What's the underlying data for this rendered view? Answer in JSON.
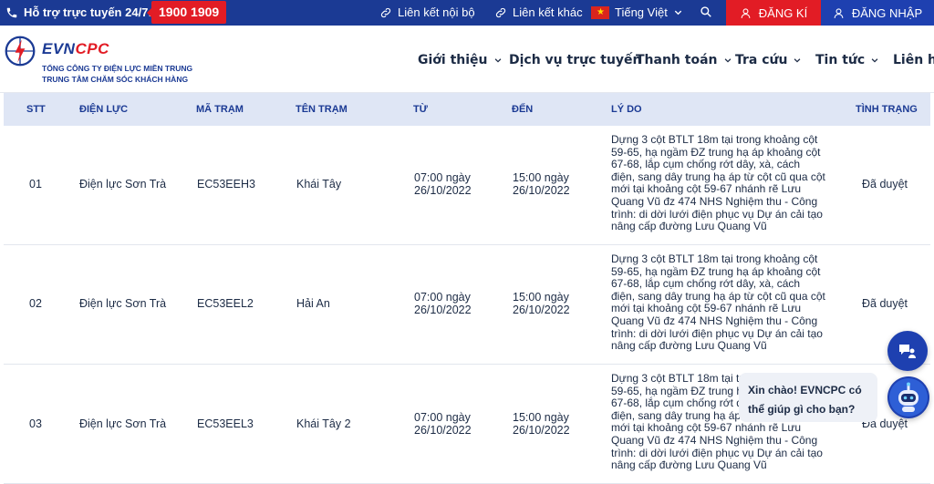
{
  "topbar": {
    "hotline_label": "Hỗ trợ trực tuyến 24/7:",
    "hotline_number": "1900 1909",
    "links": [
      {
        "label": "Liên kết nội bộ",
        "icon": "link-icon"
      },
      {
        "label": "Liên kết khác",
        "icon": "link-icon"
      }
    ],
    "language": "Tiếng Việt",
    "register": "ĐĂNG KÍ",
    "login": "ĐĂNG NHẬP"
  },
  "header": {
    "brand_part1": "EVN",
    "brand_part2": "CPC",
    "subtitle1": "TỔNG CÔNG TY ĐIỆN LỰC MIỀN TRUNG",
    "subtitle2": "TRUNG TÂM CHĂM SÓC KHÁCH HÀNG",
    "nav": [
      "Giới thiệu",
      "Dịch vụ trực tuyến",
      "Thanh toán",
      "Tra cứu",
      "Tin tức",
      "Liên hệ"
    ]
  },
  "table": {
    "columns": [
      "STT",
      "ĐIỆN LỰC",
      "MÃ TRẠM",
      "TÊN TRẠM",
      "TỪ",
      "ĐẾN",
      "LÝ DO",
      "TÌNH TRẠNG"
    ],
    "rows": [
      {
        "stt": "01",
        "dien_luc": "Điện lực Sơn Trà",
        "ma_tram": "EC53EEH3",
        "ten_tram": "Khái Tây",
        "tu_time": "07:00 ngày",
        "tu_date": "26/10/2022",
        "den_time": "15:00 ngày",
        "den_date": "26/10/2022",
        "ly_do": "Dựng 3 cột BTLT 18m tại trong khoảng cột 59-65, hạ ngầm ĐZ trung hạ áp khoảng cột 67-68, lắp cụm chống rớt dây, xà, cách điện, sang dây trung hạ áp từ cột cũ qua cột mới tại khoảng cột 59-67 nhánh rẽ Lưu Quang Vũ đz 474 NHS Nghiệm thu - Công trình: di dời lưới điện phục vụ Dự án cải tạo nâng cấp đường Lưu Quang Vũ",
        "tinh_trang": "Đã duyệt"
      },
      {
        "stt": "02",
        "dien_luc": "Điện lực Sơn Trà",
        "ma_tram": "EC53EEL2",
        "ten_tram": "Hải An",
        "tu_time": "07:00 ngày",
        "tu_date": "26/10/2022",
        "den_time": "15:00 ngày",
        "den_date": "26/10/2022",
        "ly_do": "Dựng 3 cột BTLT 18m tại trong khoảng cột 59-65, hạ ngầm ĐZ trung hạ áp khoảng cột 67-68, lắp cụm chống rớt dây, xà, cách điện, sang dây trung hạ áp từ cột cũ qua cột mới tại khoảng cột 59-67 nhánh rẽ Lưu Quang Vũ đz 474 NHS Nghiệm thu - Công trình: di dời lưới điện phục vụ Dự án cải tạo nâng cấp đường Lưu Quang Vũ",
        "tinh_trang": "Đã duyệt"
      },
      {
        "stt": "03",
        "dien_luc": "Điện lực Sơn Trà",
        "ma_tram": "EC53EEL3",
        "ten_tram": "Khái Tây 2",
        "tu_time": "07:00 ngày",
        "tu_date": "26/10/2022",
        "den_time": "15:00 ngày",
        "den_date": "26/10/2022",
        "ly_do": "Dựng 3 cột BTLT 18m tại trong khoảng cột 59-65, hạ ngầm ĐZ trung hạ áp khoảng cột 67-68, lắp cụm chống rớt dây, xà, cách điện, sang dây trung hạ áp từ cột cũ qua cột mới tại khoảng cột 59-67 nhánh rẽ Lưu Quang Vũ đz 474 NHS Nghiệm thu - Công trình: di dời lưới điện phục vụ Dự án cải tạo nâng cấp đường Lưu Quang Vũ",
        "tinh_trang": "Đã duyệt"
      }
    ]
  },
  "chat": {
    "greeting": "Xin chào! EVNCPC có thể giúp gì cho bạn?"
  },
  "colors": {
    "primary": "#1b3a94",
    "accent": "#e21c25",
    "header_row": "#dfe6f5"
  }
}
